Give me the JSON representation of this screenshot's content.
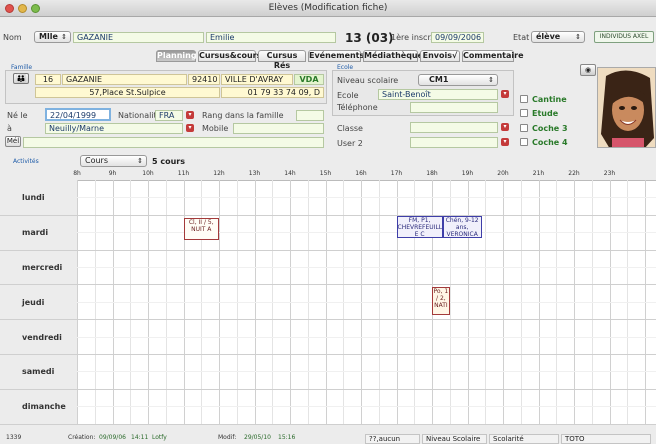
{
  "window": {
    "title": "Elèves (Modification fiche)"
  },
  "header": {
    "nom_label": "Nom",
    "civilite": "Mlle",
    "nom": "GAZANIE",
    "prenom": "Emilie",
    "numero": "13 (03)",
    "inscr_label": "1ère inscr.",
    "inscr_date": "09/09/2006",
    "etat_label": "Etat",
    "etat": "élève",
    "indiv_button": "INDIVIDUS AXEL"
  },
  "tabs": [
    "Planning",
    "Cursus&cours",
    "Cursus Rés",
    "Evénements",
    "Médiathèque",
    "Envois√",
    "Commentaire"
  ],
  "famille": {
    "section": "Famille",
    "num": "16",
    "nom": "GAZANIE",
    "cp": "92410",
    "ville": "VILLE D'AVRAY",
    "code": "VDA",
    "adresse": "57,Place St.Sulpice",
    "tel": "01 79 33 74 09, D"
  },
  "ne_le_label": "Né le",
  "date_naissance": "22/04/1999",
  "nationalite_label": "Nationalité",
  "nationalite": "FRA",
  "rang_label": "Rang dans la famille",
  "a_label": "à",
  "lieu_naissance": "Neuilly/Marne",
  "mobile_label": "Mobile",
  "mel_button": "Mél",
  "ecole": {
    "section": "Ecole",
    "niveau_label": "Niveau scolaire",
    "niveau": "CM1",
    "ecole_label": "Ecole",
    "ecole": "Saint-Benoît",
    "telephone_label": "Téléphone",
    "classe_label": "Classe",
    "user2_label": "User 2"
  },
  "checkboxes": [
    "Cantine",
    "Etude",
    "Coche 3",
    "Coche 4"
  ],
  "activites": {
    "section": "Activités",
    "filter": "Cours",
    "count": "5 cours"
  },
  "planning": {
    "hours": [
      "8h",
      "9h",
      "10h",
      "11h",
      "12h",
      "13h",
      "14h",
      "15h",
      "16h",
      "17h",
      "18h",
      "19h",
      "20h",
      "21h",
      "22h",
      "23h"
    ],
    "days": [
      "lundi",
      "mardi",
      "mercredi",
      "jeudi",
      "vendredi",
      "samedi",
      "dimanche"
    ],
    "events": [
      {
        "day": "mardi",
        "start": 11.0,
        "end": 12.0,
        "text": "Cl, II / 5, NUIT A",
        "border": "#a33a3a",
        "fill": "#fffdf6"
      },
      {
        "day": "mardi",
        "start": 17.0,
        "end": 18.3,
        "text": "FM, P1, CHEVREFEUILL E C",
        "border": "#3e3ea8",
        "fill": "#f1f0fb"
      },
      {
        "day": "mardi",
        "start": 18.3,
        "end": 19.4,
        "text": "Chén, 9-12 ans, VERONICA B",
        "border": "#3e3ea8",
        "fill": "#f1f0fb"
      },
      {
        "day": "jeudi",
        "start": 18.0,
        "end": 18.5,
        "text": "Po, 1 / 2, NATI",
        "border": "#a33a3a",
        "fill": "#fff6e6"
      }
    ]
  },
  "status": {
    "id": "1339",
    "creation_label": "Création:",
    "creation_date": "09/09/06",
    "creation_time": "14:11",
    "creation_user": "Lotfy",
    "modif_label": "Modif:",
    "modif_date": "29/05/10",
    "modif_time": "15:16",
    "box1": "??,aucun",
    "box2": "Niveau Scolaire",
    "box3": "Scolarité",
    "box4": "TOTO"
  }
}
